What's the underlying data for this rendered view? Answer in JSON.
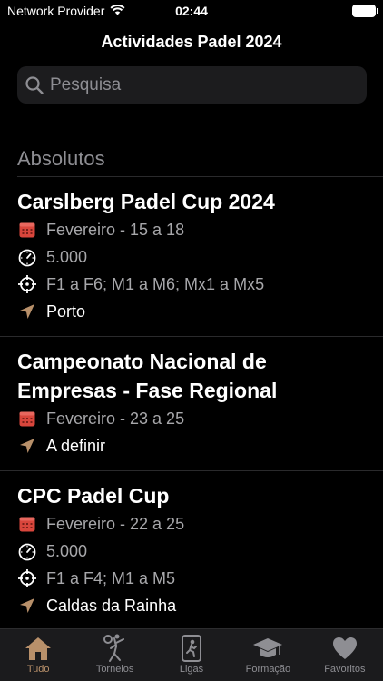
{
  "status_bar": {
    "carrier": "Network Provider",
    "time": "02:44"
  },
  "nav": {
    "title": "Actividades Padel 2024"
  },
  "search": {
    "placeholder": "Pesquisa"
  },
  "section": {
    "title": "Absolutos"
  },
  "events": [
    {
      "title": "Carslberg Padel Cup 2024",
      "date": "Fevereiro - 15 a 18",
      "prize": "5.000",
      "categories": "F1 a F6; M1 a M6; Mx1 a Mx5",
      "location": "Porto"
    },
    {
      "title": "Campeonato Nacional de Empresas - Fase Regional",
      "date": "Fevereiro - 23 a 25",
      "location": "A definir"
    },
    {
      "title": "CPC Padel Cup",
      "date": "Fevereiro - 22 a 25",
      "prize": "5.000",
      "categories": "F1 a F4; M1 a M5",
      "location": "Caldas da Rainha"
    }
  ],
  "tabs": [
    {
      "label": "Tudo",
      "icon": "house-icon",
      "active": true
    },
    {
      "label": "Torneios",
      "icon": "player-icon",
      "active": false
    },
    {
      "label": "Ligas",
      "icon": "league-icon",
      "active": false
    },
    {
      "label": "Formação",
      "icon": "graduation-cap-icon",
      "active": false
    },
    {
      "label": "Favoritos",
      "icon": "heart-icon",
      "active": false
    }
  ],
  "colors": {
    "accent": "#b8906a",
    "calendar": "#d9463c",
    "background": "#000000",
    "secondary_text": "#a7a7aa"
  }
}
